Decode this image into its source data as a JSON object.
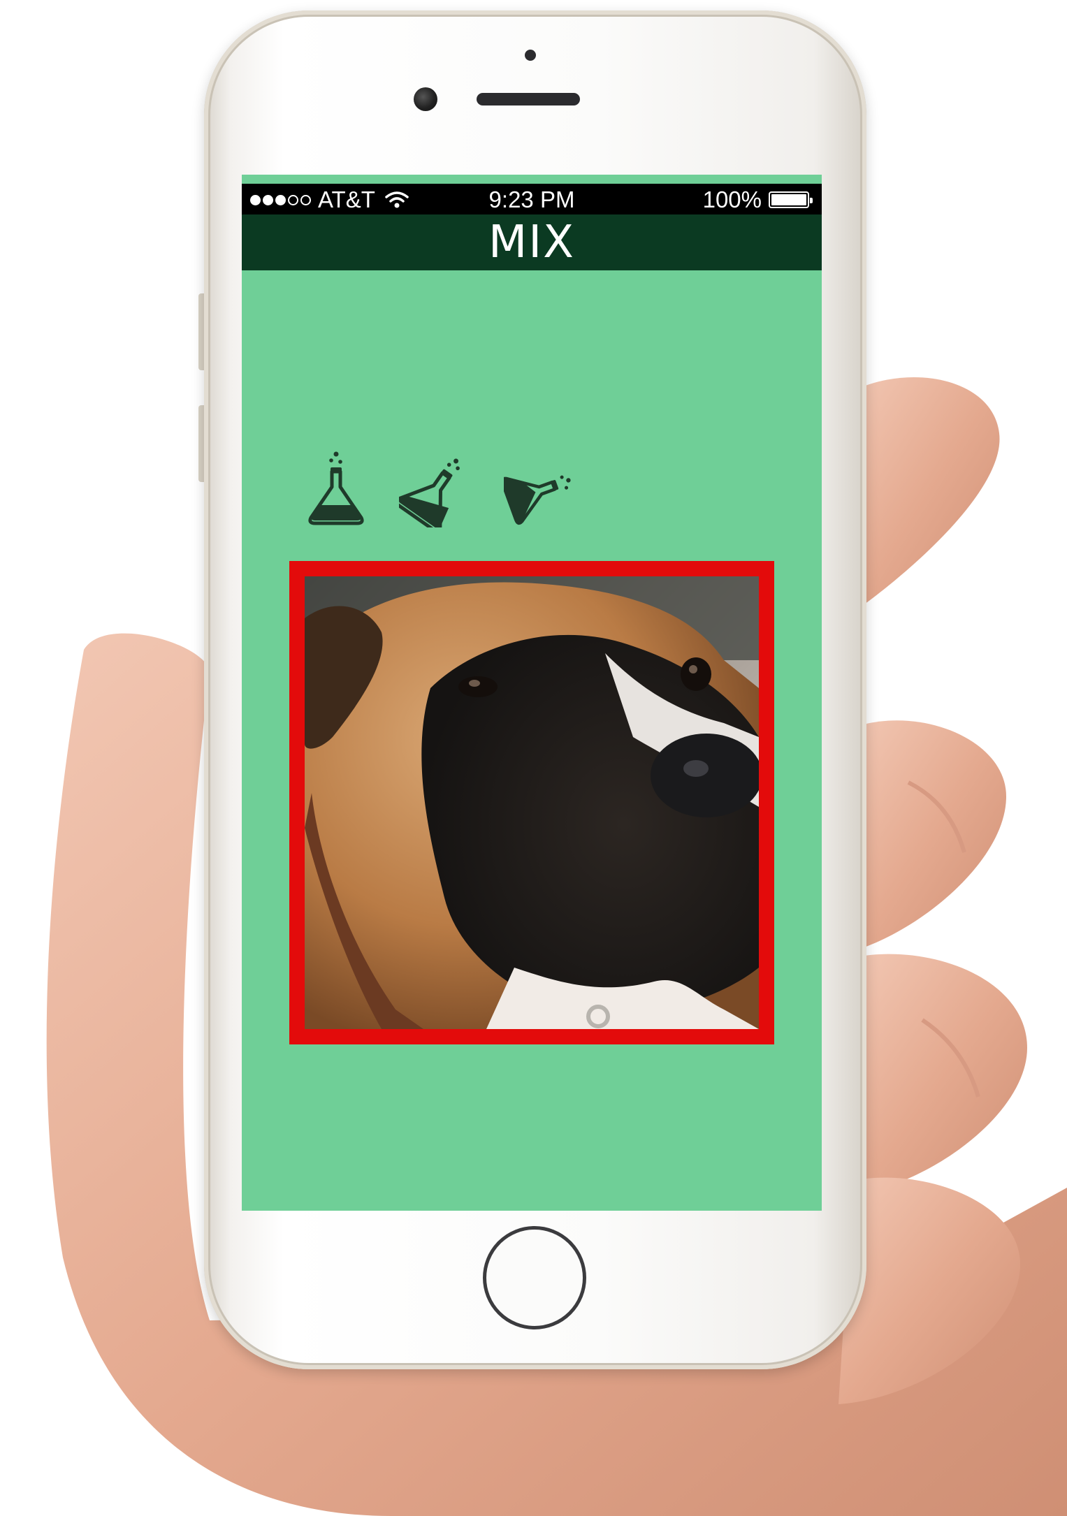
{
  "status_bar": {
    "carrier": "AT&T",
    "signal_bars_filled": 3,
    "signal_bars_total": 5,
    "time": "9:23 PM",
    "battery": "100%",
    "battery_level": 1.0
  },
  "nav": {
    "title": "MIX"
  },
  "icons": {
    "mix_options": [
      "flask-upright-icon",
      "flask-tilted-icon",
      "flask-pouring-icon"
    ],
    "status": [
      "signal-dots-icon",
      "wifi-icon",
      "battery-icon"
    ]
  },
  "photo": {
    "subject": "boxer-dog-face",
    "frame_color": "#e30b0b"
  },
  "colors": {
    "screen_background": "#6fcf97",
    "nav_background": "#0b3a22",
    "status_background": "#000000"
  }
}
